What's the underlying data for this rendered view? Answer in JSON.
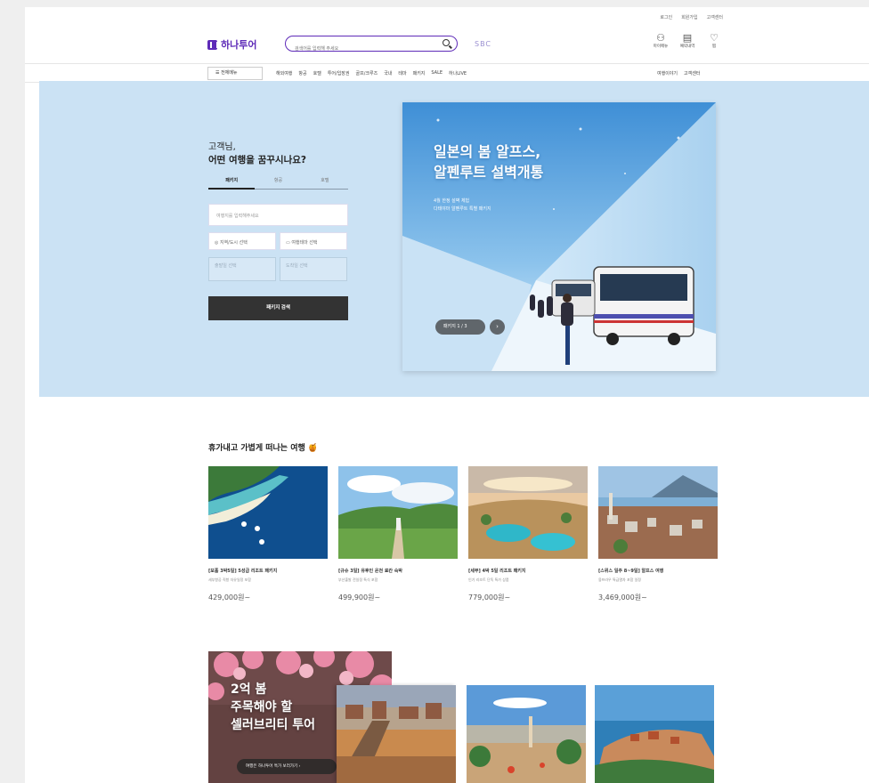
{
  "header": {
    "util_links": [
      "로그인",
      "회원가입",
      "고객센터"
    ],
    "logo_text": "하나투어",
    "search_placeholder": "검색어를 입력해 주세요",
    "promo_logo": "SBC",
    "icons": [
      {
        "name": "user-icon",
        "glyph": "⚇",
        "label": "마이메뉴"
      },
      {
        "name": "calendar-icon",
        "glyph": "▤",
        "label": "예약내역"
      },
      {
        "name": "heart-icon",
        "glyph": "♡",
        "label": "찜"
      }
    ]
  },
  "nav": {
    "all_menu": "☰ 전체메뉴",
    "items": [
      "해외여행",
      "항공",
      "호텔",
      "투어/입장권",
      "골프/크루즈",
      "국내",
      "테마",
      "패키지",
      "SALE",
      "하나LIVE"
    ],
    "right": [
      "여행이야기",
      "고객센터"
    ]
  },
  "hero": {
    "greeting_line1": "고객님,",
    "greeting_line2": "어떤 여행을 꿈꾸시나요?",
    "tabs": [
      "패키지",
      "항공",
      "호텔"
    ],
    "active_tab": 0,
    "destination_placeholder": "여행지를 입력해주세요",
    "option_left": "◎ 지역/도시 선택",
    "option_right": "▭ 여행테마 선택",
    "date_from_label": "출발일 선택",
    "date_to_label": "도착일 선택",
    "search_button": "패키지 검색",
    "banner_title_line1": "일본의 봄 알프스,",
    "banner_title_line2": "알펜루트 설벽개통",
    "banner_sub_line1": "4월 한정 설벽 체험",
    "banner_sub_line2": "다테야마 알펜루트 특별 패키지",
    "pager": "패키지  1 / 3",
    "pager_next": "›"
  },
  "products": {
    "section_title": "휴가내고 가볍게 떠나는 여행 🍯",
    "items": [
      {
        "title": "[보홀 3박5일] 5성급 리조트 패키지",
        "desc": "세부항공 직항 자유일정 포함",
        "price": "429,000원~"
      },
      {
        "title": "[규슈 3일] 유후인 온천 료칸 숙박",
        "desc": "부산출발 전일정 특식 포함",
        "price": "499,900원~"
      },
      {
        "title": "[세부] 4박 5일 리조트 패키지",
        "desc": "인기 리조트 단독 특가 상품",
        "price": "779,000원~"
      },
      {
        "title": "[스위스 일주 8~9일] 알프스 여행",
        "desc": "융프라우 특급열차 포함 일정",
        "price": "3,469,000원~"
      }
    ]
  },
  "feature": {
    "line1": "2억 봄",
    "line2": "주목해야 할",
    "line3": "셀러브리티 투어",
    "cta": "여행은 하나투어 특가 보러가기  ›"
  },
  "colors": {
    "brand": "#5e2bb8",
    "hero_bg": "#cbe2f4",
    "search_button": "#333333"
  }
}
